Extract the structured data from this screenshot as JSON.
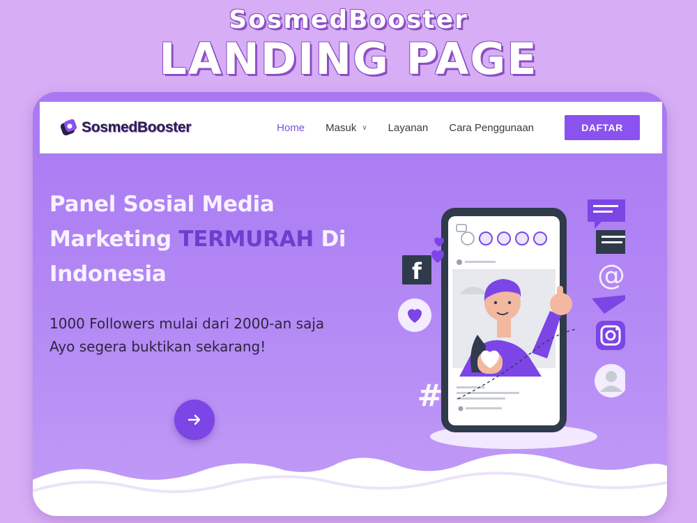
{
  "promo": {
    "line1": "SosmedBooster",
    "line2": "LANDING PAGE"
  },
  "brand": {
    "name": "SosmedBooster"
  },
  "nav": {
    "items": [
      {
        "label": "Home",
        "active": true
      },
      {
        "label": "Masuk",
        "dropdown": true
      },
      {
        "label": "Layanan"
      },
      {
        "label": "Cara Penggunaan"
      }
    ],
    "cta_label": "DAFTAR"
  },
  "hero": {
    "title_part1": "Panel Sosial Media Marketing ",
    "title_highlight": "TERMURAH",
    "title_part2": " Di Indonesia",
    "subtitle_line1": "1000 Followers mulai dari 2000-an saja",
    "subtitle_line2": "Ayo segera buktikan sekarang!"
  },
  "colors": {
    "background": "#d7aef5",
    "accent": "#8a52ef",
    "highlight": "#6b3fcf"
  }
}
